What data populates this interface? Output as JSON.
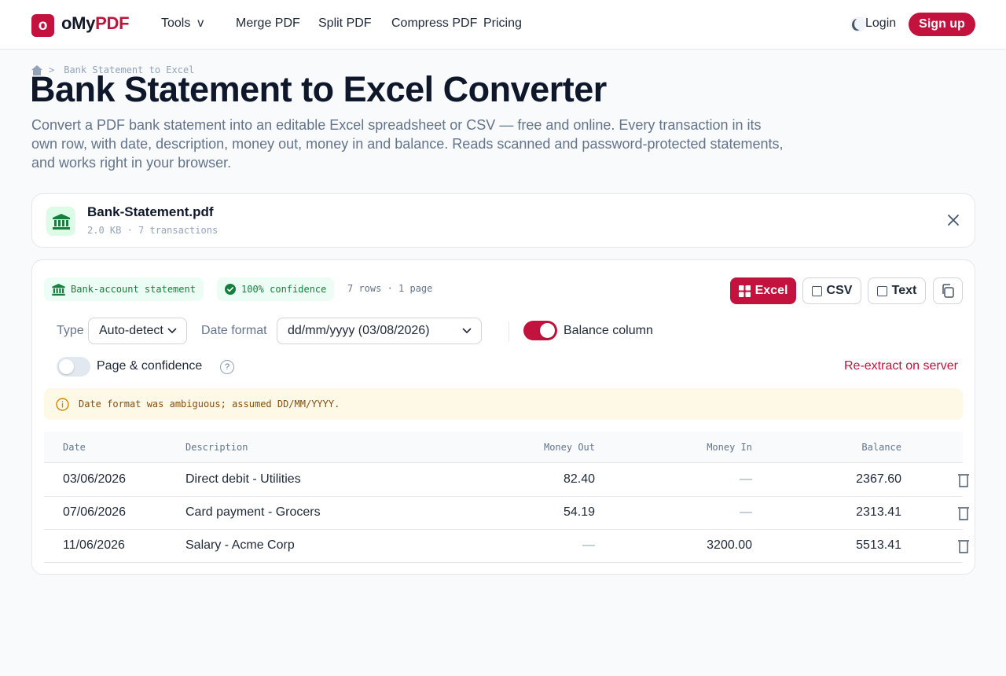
{
  "nav": {
    "logo_letter": "o",
    "logo_prefix": "oMy",
    "logo_suffix": "PDF",
    "tools": "Tools",
    "tools_caret": "v",
    "merge": "Merge PDF",
    "split": "Split PDF",
    "compress": "Compress PDF",
    "pricing": "Pricing",
    "theme_icon": "moon-icon",
    "login": "Login",
    "signup": "Sign up"
  },
  "breadcrumb": {
    "home_icon": "home-icon",
    "separator": ">",
    "current": "Bank Statement to Excel"
  },
  "page": {
    "title": "Bank Statement to Excel Converter",
    "description": "Convert a PDF bank statement into an editable Excel spreadsheet or CSV — free and online. Every transaction in its own row, with date, description, money out, money in and balance. Reads scanned and password-protected statements, and works right in your browser."
  },
  "file": {
    "icon": "bank-icon",
    "name": "Bank-Statement.pdf",
    "meta": "2.0 KB · 7 transactions"
  },
  "result": {
    "type_badge": "Bank-account statement",
    "confidence_badge": "100% confidence",
    "info": "7 rows · 1 page",
    "export": {
      "excel": "Excel",
      "csv": "CSV",
      "text": "Text"
    },
    "options": {
      "type_label": "Type",
      "type_value": "Auto-detect",
      "date_format_label": "Date format",
      "date_format_value": "dd/mm/yyyy (03/08/2026)",
      "balance_column_label": "Balance column",
      "balance_column_on": true,
      "page_confidence_label": "Page & confidence",
      "page_confidence_on": false,
      "help": "?",
      "reextract": "Re-extract on server"
    },
    "warning": "Date format was ambiguous; assumed DD/MM/YYYY.",
    "table": {
      "headers": [
        "Date",
        "Description",
        "Money Out",
        "Money In",
        "Balance"
      ],
      "rows": [
        [
          "03/06/2026",
          "Direct debit - Utilities",
          "82.40",
          "—",
          "2367.60"
        ],
        [
          "07/06/2026",
          "Card payment - Grocers",
          "54.19",
          "—",
          "2313.41"
        ],
        [
          "11/06/2026",
          "Salary - Acme Corp",
          "—",
          "3200.00",
          "5513.41"
        ]
      ]
    }
  },
  "colors": {
    "brand": "#c2123d",
    "success": "#15803d",
    "warning_bg": "#fef9e7"
  }
}
